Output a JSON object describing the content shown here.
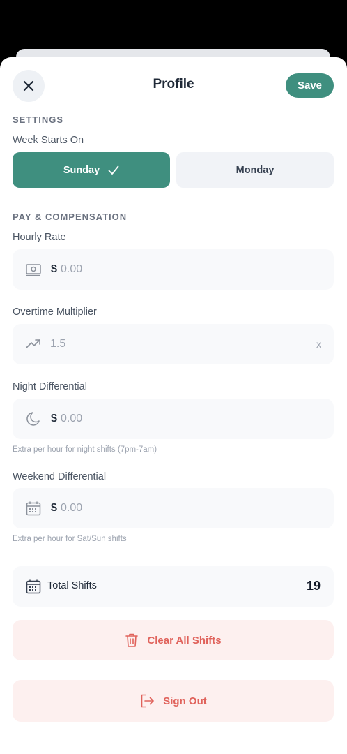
{
  "header": {
    "title": "Profile",
    "save_label": "Save"
  },
  "settings": {
    "section_title": "SETTINGS",
    "week_label": "Week Starts On",
    "options": [
      {
        "label": "Sunday",
        "selected": true
      },
      {
        "label": "Monday",
        "selected": false
      }
    ]
  },
  "pay": {
    "section_title": "PAY & COMPENSATION",
    "hourly": {
      "label": "Hourly Rate",
      "prefix": "$",
      "placeholder": "0.00",
      "icon": "money-icon"
    },
    "overtime": {
      "label": "Overtime Multiplier",
      "placeholder": "1.5",
      "suffix": "x",
      "icon": "trending-up-icon"
    },
    "night": {
      "label": "Night Differential",
      "prefix": "$",
      "placeholder": "0.00",
      "helper": "Extra per hour for night shifts (7pm-7am)",
      "icon": "moon-icon"
    },
    "weekend": {
      "label": "Weekend Differential",
      "prefix": "$",
      "placeholder": "0.00",
      "helper": "Extra per hour for Sat/Sun shifts",
      "icon": "calendar-icon"
    }
  },
  "stats": {
    "label": "Total Shifts",
    "value": "19",
    "icon": "calendar-icon"
  },
  "actions": {
    "clear_label": "Clear All Shifts",
    "signout_label": "Sign Out"
  },
  "colors": {
    "accent": "#3f8f7f",
    "danger": "#e0625b",
    "danger_bg": "#fdf0ef"
  }
}
